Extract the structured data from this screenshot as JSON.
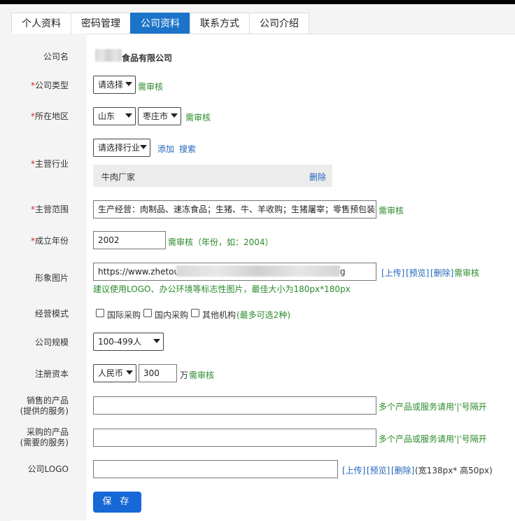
{
  "tabs": [
    {
      "label": "个人资料",
      "active": false
    },
    {
      "label": "密码管理",
      "active": false
    },
    {
      "label": "公司资料",
      "active": true
    },
    {
      "label": "联系方式",
      "active": false
    },
    {
      "label": "公司介绍",
      "active": false
    }
  ],
  "company_name": {
    "label": "公司名",
    "value": "食品有限公司"
  },
  "company_type": {
    "required": "*",
    "label": "公司类型",
    "selected": "请选择",
    "note": "需审核"
  },
  "region": {
    "required": "*",
    "label": "所在地区",
    "province": "山东",
    "city": "枣庄市",
    "note": "需审核"
  },
  "industry": {
    "required": "*",
    "label": "主营行业",
    "selected": "请选择行业",
    "add_link": "添加",
    "search_link": "搜索",
    "item": "牛肉厂家",
    "delete_link": "删除"
  },
  "scope": {
    "required": "*",
    "label": "主营范围",
    "value": "生产经营：肉制品、速冻食品；生猪、牛、羊收购；生猪屠宰；零售预包装食品（",
    "note": "需审核"
  },
  "founded": {
    "required": "*",
    "label": "成立年份",
    "value": "2002",
    "note": "需审核（年份，如：2004）"
  },
  "image": {
    "label": "形象图片",
    "value_start": "https://www.zhetouni",
    "value_end": "g",
    "upload": "[上传]",
    "preview": "[预览]",
    "delete": "[删除]",
    "note": "需审核",
    "hint": "建议使用LOGO、办公环境等标志性图片，最佳大小为180px*180px"
  },
  "mode": {
    "label": "经营模式",
    "options": [
      "国际采购",
      "国内采购",
      "其他机构"
    ],
    "note": "(最多可选2种)"
  },
  "scale": {
    "label": "公司规模",
    "selected": "100-499人"
  },
  "capital": {
    "label": "注册资本",
    "currency": "人民币",
    "amount": "300",
    "unit": "万",
    "note": "需审核"
  },
  "sell": {
    "label_line1": "销售的产品",
    "label_line2": "(提供的服务)",
    "value": "",
    "note": "多个产品或服务请用'|'号隔开"
  },
  "buy": {
    "label_line1": "采购的产品",
    "label_line2": "(需要的服务)",
    "value": "",
    "note": "多个产品或服务请用'|'号隔开"
  },
  "logo": {
    "label": "公司LOGO",
    "value": "",
    "upload": "[上传]",
    "preview": "[预览]",
    "delete": "[删除]",
    "size_note": "(宽138px* 高50px)"
  },
  "save_label": "保 存"
}
